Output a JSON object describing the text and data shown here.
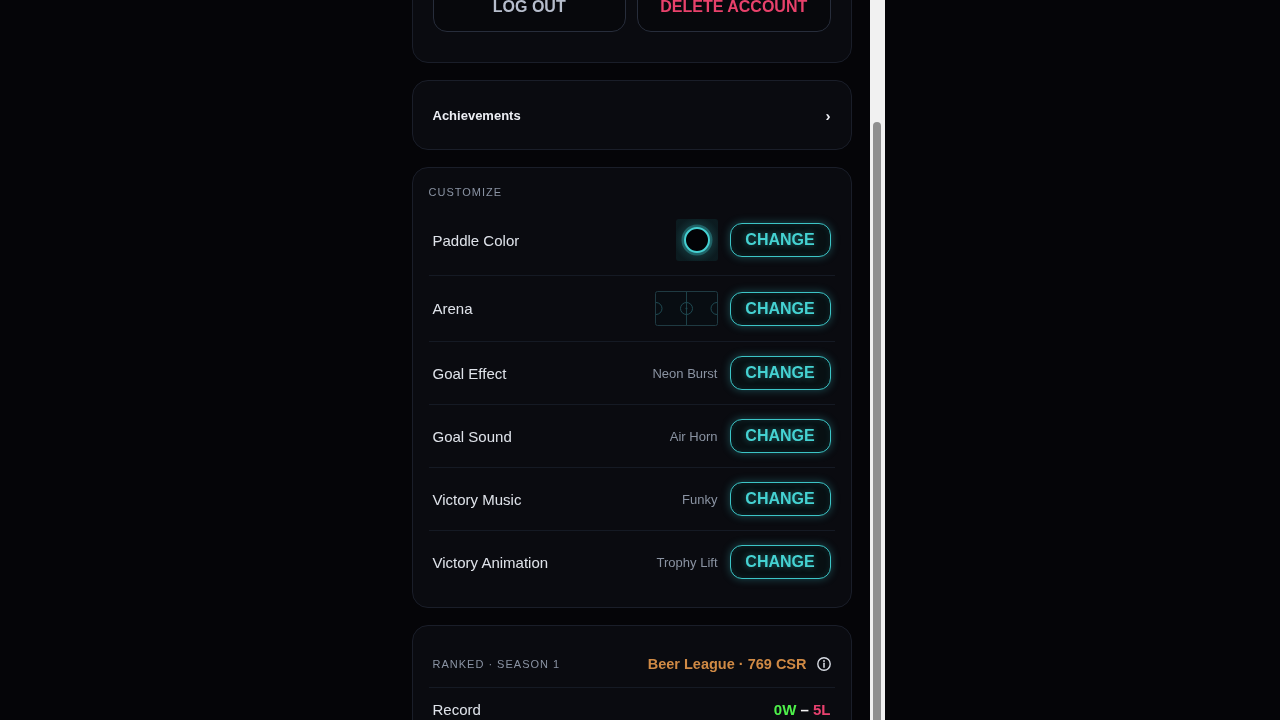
{
  "account_actions": {
    "buttons": [
      {
        "label": "LOG OUT",
        "kind": "neutral"
      },
      {
        "label": "DELETE ACCOUNT",
        "kind": "danger"
      }
    ]
  },
  "achievements": {
    "label": "Achievements",
    "chevron": "›"
  },
  "customize": {
    "heading": "CUSTOMIZE",
    "rows": [
      {
        "label": "Paddle Color",
        "kind": "swatch",
        "button": "CHANGE"
      },
      {
        "label": "Arena",
        "kind": "arena",
        "button": "CHANGE"
      },
      {
        "label": "Goal Effect",
        "kind": "text",
        "value": "Neon Burst",
        "button": "CHANGE"
      },
      {
        "label": "Goal Sound",
        "kind": "text",
        "value": "Air Horn",
        "button": "CHANGE"
      },
      {
        "label": "Victory Music",
        "kind": "text",
        "value": "Funky",
        "button": "CHANGE"
      },
      {
        "label": "Victory Animation",
        "kind": "text",
        "value": "Trophy Lift",
        "button": "CHANGE"
      }
    ]
  },
  "ranked": {
    "heading": "RANKED · SEASON 1",
    "rank": "Beer League · 769 CSR",
    "stats": [
      {
        "label": "Record",
        "wins": "0W",
        "separator": "–",
        "losses": "5L"
      }
    ]
  }
}
